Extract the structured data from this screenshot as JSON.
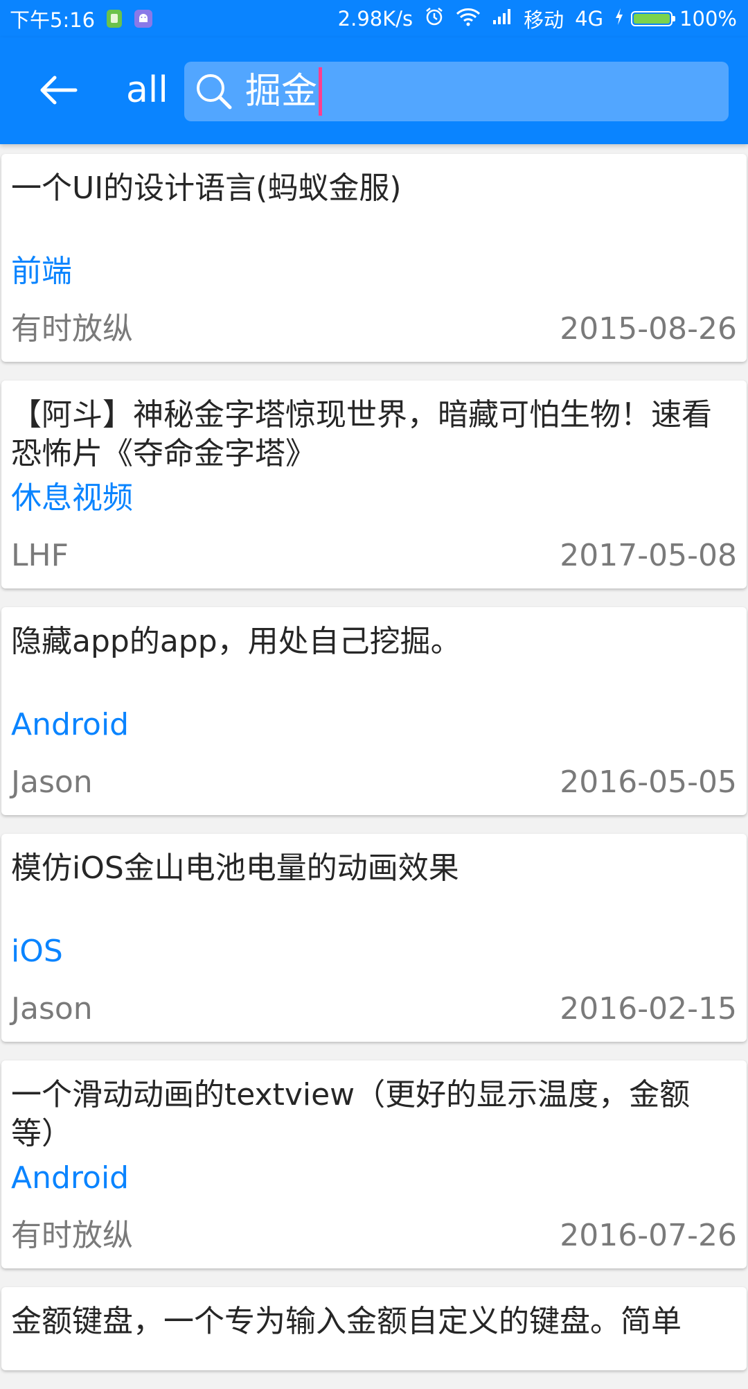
{
  "colors": {
    "primary": "#0a84ff",
    "search_bg": "#52a6ff",
    "cursor": "#ff3e8e",
    "tag": "#0a84ff",
    "meta": "#7a7a7a",
    "title": "#262626",
    "battery": "#7bd34d"
  },
  "status_bar": {
    "time": "下午5:16",
    "notif_icons": [
      "sim-icon",
      "android-app-icon"
    ],
    "speed": "2.98K/s",
    "icons": [
      "alarm-icon",
      "wifi-icon",
      "signal-icon"
    ],
    "carrier": "移动",
    "network": "4G",
    "charging_icon": "bolt-icon",
    "battery_percent": "100%",
    "battery_level": 1.0
  },
  "app_bar": {
    "back_icon": "arrow-left-icon",
    "scope": "all",
    "search": {
      "icon": "search-icon",
      "value": "掘金"
    }
  },
  "results": [
    {
      "title": "一个UI的设计语言(蚂蚁金服)",
      "tag": "前端",
      "author": "有时放纵",
      "date": "2015-08-26"
    },
    {
      "title": "【阿斗】神秘金字塔惊现世界，暗藏可怕生物！速看恐怖片《夺命金字塔》",
      "tag": "休息视频",
      "author": "LHF",
      "date": "2017-05-08"
    },
    {
      "title": "隐藏app的app，用处自己挖掘。",
      "tag": "Android",
      "author": "Jason",
      "date": "2016-05-05"
    },
    {
      "title": "模仿iOS金山电池电量的动画效果",
      "tag": "iOS",
      "author": "Jason",
      "date": "2016-02-15"
    },
    {
      "title": "一个滑动动画的textview（更好的显示温度，金额等）",
      "tag": "Android",
      "author": "有时放纵",
      "date": "2016-07-26"
    },
    {
      "title": "金额键盘，一个专为输入金额自定义的键盘。简单"
    }
  ]
}
